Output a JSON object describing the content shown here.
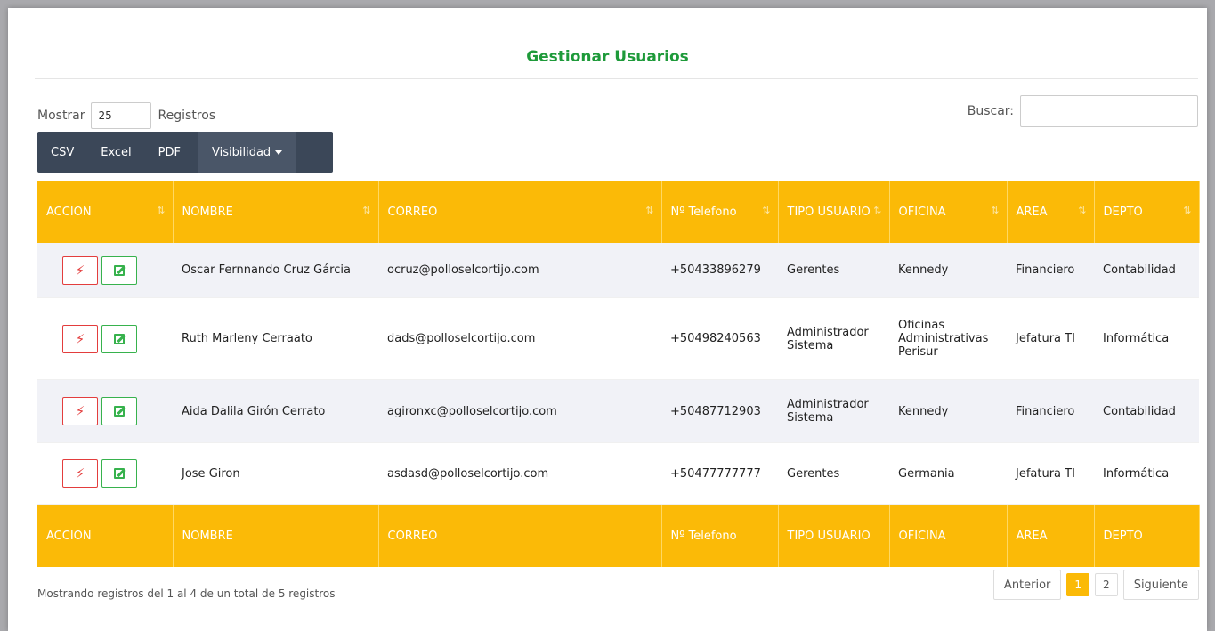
{
  "title": "Gestionar Usuarios",
  "length": {
    "prefix": "Mostrar",
    "value": "25",
    "suffix": "Registros"
  },
  "search": {
    "label": "Buscar:",
    "placeholder": ""
  },
  "buttons": {
    "csv": "CSV",
    "excel": "Excel",
    "pdf": "PDF",
    "visibility": "Visibilidad"
  },
  "columns": [
    "ACCION",
    "NOMBRE",
    "CORREO",
    "Nº Telefono",
    "TIPO USUARIO",
    "OFICINA",
    "AREA",
    "DEPTO"
  ],
  "sort_icon": "⇅",
  "action_icons": {
    "power": "power-plug-icon",
    "edit": "edit-icon"
  },
  "rows": [
    {
      "nombre": "Oscar Fernnando Cruz Gárcia",
      "correo": "ocruz@polloselcortijo.com",
      "telefono": "+50433896279",
      "tipo": "Gerentes",
      "oficina": "Kennedy",
      "area": "Financiero",
      "depto": "Contabilidad"
    },
    {
      "nombre": "Ruth Marleny Cerraato",
      "correo": "dads@polloselcortijo.com",
      "telefono": "+50498240563",
      "tipo": "Administrador Sistema",
      "oficina": "Oficinas Administrativas Perisur",
      "area": "Jefatura TI",
      "depto": "Informática"
    },
    {
      "nombre": "Aida Dalila Girón Cerrato",
      "correo": "agironxc@polloselcortijo.com",
      "telefono": "+50487712903",
      "tipo": "Administrador Sistema",
      "oficina": "Kennedy",
      "area": "Financiero",
      "depto": "Contabilidad"
    },
    {
      "nombre": "Jose Giron",
      "correo": "asdasd@polloselcortijo.com",
      "telefono": "+50477777777",
      "tipo": "Gerentes",
      "oficina": "Germania",
      "area": "Jefatura TI",
      "depto": "Informática"
    }
  ],
  "info": "Mostrando registros del 1 al 4 de un total de 5 registros",
  "pagination": {
    "prev": "Anterior",
    "pages": [
      "1",
      "2"
    ],
    "active": "1",
    "next": "Siguiente"
  },
  "colors": {
    "accent": "#fbba07",
    "title": "#1e9a3a",
    "toolbar": "#3b4758"
  }
}
